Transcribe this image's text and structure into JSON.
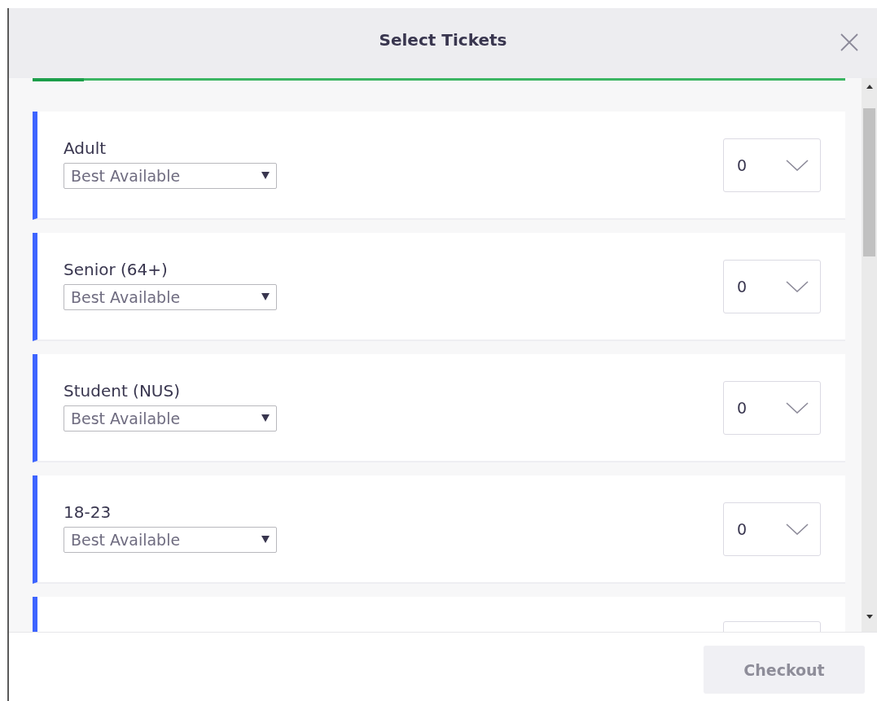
{
  "dialog": {
    "title": "Select Tickets"
  },
  "progress": {
    "level": 0.063
  },
  "tickets": [
    {
      "name": "Adult",
      "seating": "Best Available",
      "quantity": "0"
    },
    {
      "name": "Senior (64+)",
      "seating": "Best Available",
      "quantity": "0"
    },
    {
      "name": "Student (NUS)",
      "seating": "Best Available",
      "quantity": "0"
    },
    {
      "name": "18-23",
      "seating": "Best Available",
      "quantity": "0"
    }
  ],
  "checkout": {
    "label": "Checkout",
    "disabled": true
  }
}
